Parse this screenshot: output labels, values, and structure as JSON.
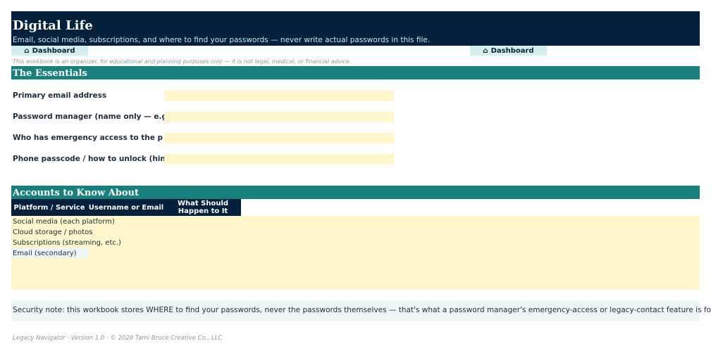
{
  "header": {
    "title": "Digital Life",
    "subtitle": "Email, social media, subscriptions, and where to find your passwords — never write actual passwords in this file."
  },
  "nav": {
    "home_icon": "⌂",
    "dashboard_label": "Dashboard"
  },
  "disclaimer": "This workbook is an organizer, for educational and planning purposes only — it is not legal, medical, or financial advice.",
  "essentials": {
    "title": "The Essentials",
    "fields": [
      {
        "label": "Primary email address",
        "value": ""
      },
      {
        "label": "Password manager (name only — e.g.",
        "value": ""
      },
      {
        "label": "Who has emergency access to the p",
        "value": ""
      },
      {
        "label": "Phone passcode / how to unlock (hint",
        "value": ""
      }
    ]
  },
  "accounts": {
    "title": "Accounts to Know About",
    "columns": [
      "Platform / Service",
      "Username or Email",
      "What Should Happen to It"
    ],
    "rows": [
      "Social media (each platform)",
      "Cloud storage / photos",
      "Subscriptions (streaming, etc.)",
      "Email (secondary)"
    ]
  },
  "security_note": "Security note: this workbook stores WHERE to find your passwords, never the passwords themselves — that's what a password manager's emergency-access or legacy-contact feature is for.",
  "footer": "Legacy Navigator · Version 1.0 · © 2026 Tami Bruce Creative Co., LLC",
  "colors": {
    "navy": "#03213d",
    "teal": "#177f7c",
    "input_yellow": "#fff6cc",
    "mint": "#d3eeeb"
  }
}
